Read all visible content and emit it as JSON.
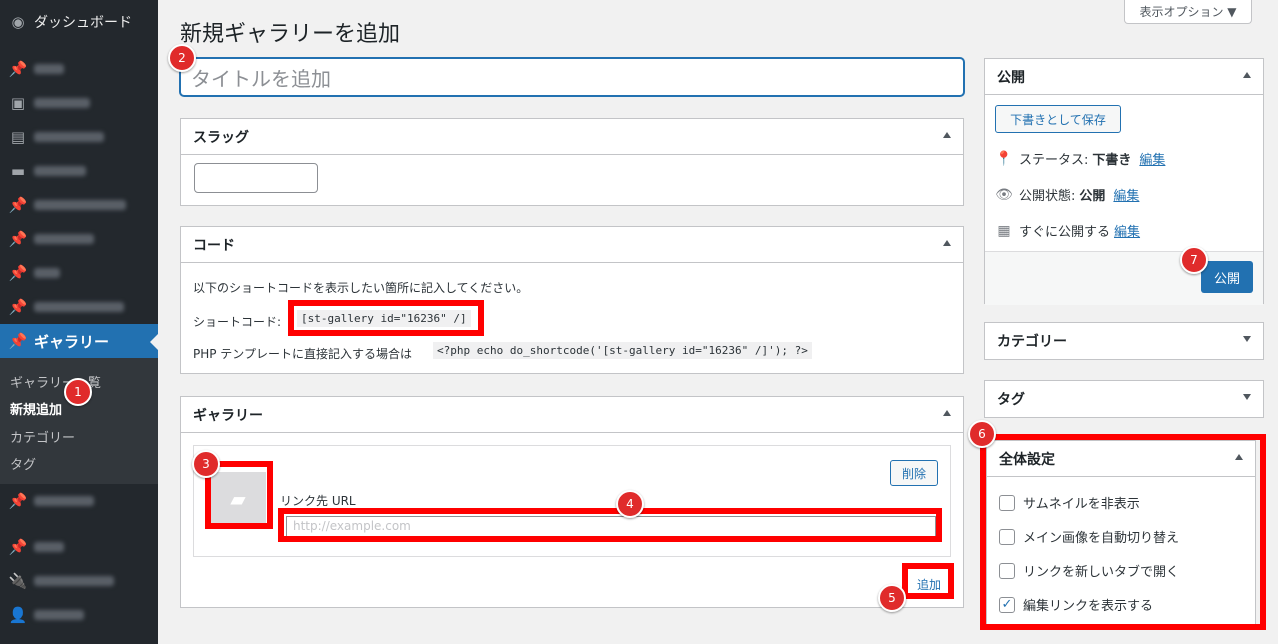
{
  "sidebar": {
    "dashboard": "ダッシュボード",
    "gallery": "ギャラリー",
    "submenu": [
      "ギャラリー一覧",
      "新規追加",
      "カテゴリー",
      "タグ"
    ]
  },
  "screen_options": "表示オプション ▼",
  "page_title": "新規ギャラリーを追加",
  "title_placeholder": "タイトルを追加",
  "slug_box": {
    "title": "スラッグ"
  },
  "code_box": {
    "title": "コード",
    "instruction": "以下のショートコードを表示したい箇所に記入してください。",
    "shortcode_label": "ショートコード:",
    "shortcode": "[st-gallery id=\"16236\" /]",
    "php_label": "PHP テンプレートに直接記入する場合は",
    "php_code": "<?php echo do_shortcode('[st-gallery id=\"16236\" /]'); ?>"
  },
  "gallery_box": {
    "title": "ギャラリー",
    "delete_button": "削除",
    "link_label": "リンク先 URL",
    "url_placeholder": "http://example.com",
    "add_button": "追加"
  },
  "publish_box": {
    "title": "公開",
    "save_draft": "下書きとして保存",
    "status_label": "ステータス:",
    "status_value": "下書き",
    "visibility_label": "公開状態:",
    "visibility_value": "公開",
    "schedule_label": "すぐに公開する",
    "edit_link": "編集",
    "publish_button": "公開"
  },
  "category_box": {
    "title": "カテゴリー"
  },
  "tag_box": {
    "title": "タグ"
  },
  "settings_box": {
    "title": "全体設定",
    "options": [
      {
        "label": "サムネイルを非表示",
        "checked": false
      },
      {
        "label": "メイン画像を自動切り替え",
        "checked": false
      },
      {
        "label": "リンクを新しいタブで開く",
        "checked": false
      },
      {
        "label": "編集リンクを表示する",
        "checked": true
      }
    ]
  },
  "badges": [
    "1",
    "2",
    "3",
    "4",
    "5",
    "6",
    "7"
  ],
  "colors": {
    "accent": "#2271b1",
    "highlight": "#ff0000",
    "badge": "#e02b2b",
    "sidebar": "#23282d"
  }
}
